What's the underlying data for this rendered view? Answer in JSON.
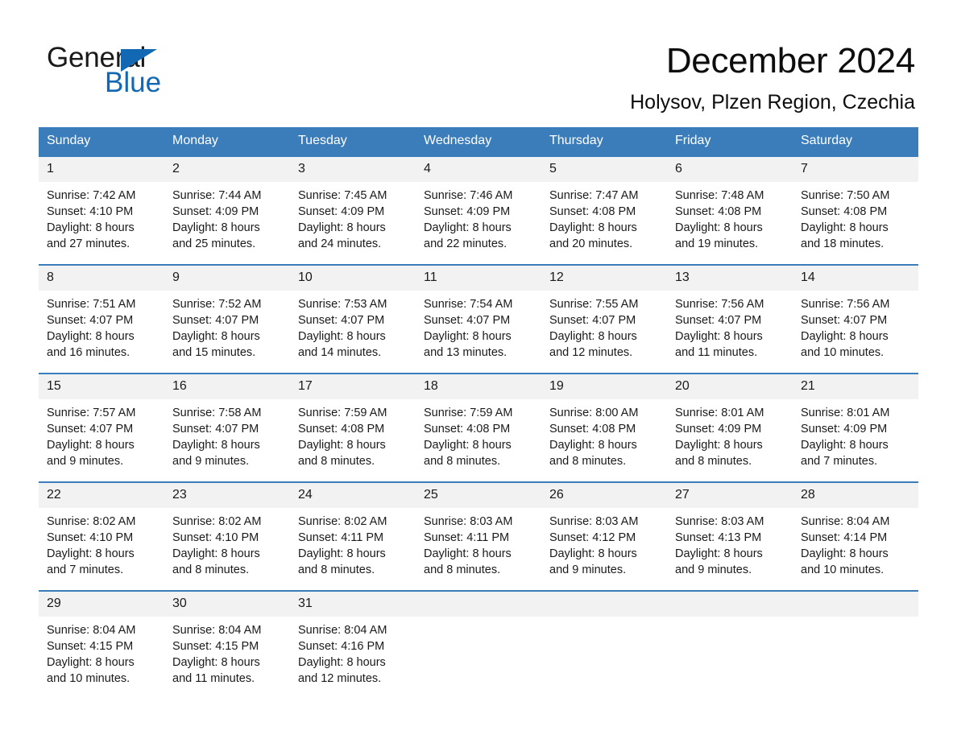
{
  "brand": {
    "name_part1": "General",
    "name_part2": "Blue",
    "triangle_icon": "triangle-icon",
    "accent_color": "#1268b3"
  },
  "header": {
    "month_title": "December 2024",
    "location": "Holysov, Plzen Region, Czechia"
  },
  "calendar": {
    "header_color": "#3b7cba",
    "weekday_headers": [
      "Sunday",
      "Monday",
      "Tuesday",
      "Wednesday",
      "Thursday",
      "Friday",
      "Saturday"
    ],
    "labels": {
      "sunrise": "Sunrise:",
      "sunset": "Sunset:",
      "daylight": "Daylight:"
    },
    "weeks": [
      [
        {
          "day": "1",
          "sunrise": "Sunrise: 7:42 AM",
          "sunset": "Sunset: 4:10 PM",
          "daylight_line1": "Daylight: 8 hours",
          "daylight_line2": "and 27 minutes."
        },
        {
          "day": "2",
          "sunrise": "Sunrise: 7:44 AM",
          "sunset": "Sunset: 4:09 PM",
          "daylight_line1": "Daylight: 8 hours",
          "daylight_line2": "and 25 minutes."
        },
        {
          "day": "3",
          "sunrise": "Sunrise: 7:45 AM",
          "sunset": "Sunset: 4:09 PM",
          "daylight_line1": "Daylight: 8 hours",
          "daylight_line2": "and 24 minutes."
        },
        {
          "day": "4",
          "sunrise": "Sunrise: 7:46 AM",
          "sunset": "Sunset: 4:09 PM",
          "daylight_line1": "Daylight: 8 hours",
          "daylight_line2": "and 22 minutes."
        },
        {
          "day": "5",
          "sunrise": "Sunrise: 7:47 AM",
          "sunset": "Sunset: 4:08 PM",
          "daylight_line1": "Daylight: 8 hours",
          "daylight_line2": "and 20 minutes."
        },
        {
          "day": "6",
          "sunrise": "Sunrise: 7:48 AM",
          "sunset": "Sunset: 4:08 PM",
          "daylight_line1": "Daylight: 8 hours",
          "daylight_line2": "and 19 minutes."
        },
        {
          "day": "7",
          "sunrise": "Sunrise: 7:50 AM",
          "sunset": "Sunset: 4:08 PM",
          "daylight_line1": "Daylight: 8 hours",
          "daylight_line2": "and 18 minutes."
        }
      ],
      [
        {
          "day": "8",
          "sunrise": "Sunrise: 7:51 AM",
          "sunset": "Sunset: 4:07 PM",
          "daylight_line1": "Daylight: 8 hours",
          "daylight_line2": "and 16 minutes."
        },
        {
          "day": "9",
          "sunrise": "Sunrise: 7:52 AM",
          "sunset": "Sunset: 4:07 PM",
          "daylight_line1": "Daylight: 8 hours",
          "daylight_line2": "and 15 minutes."
        },
        {
          "day": "10",
          "sunrise": "Sunrise: 7:53 AM",
          "sunset": "Sunset: 4:07 PM",
          "daylight_line1": "Daylight: 8 hours",
          "daylight_line2": "and 14 minutes."
        },
        {
          "day": "11",
          "sunrise": "Sunrise: 7:54 AM",
          "sunset": "Sunset: 4:07 PM",
          "daylight_line1": "Daylight: 8 hours",
          "daylight_line2": "and 13 minutes."
        },
        {
          "day": "12",
          "sunrise": "Sunrise: 7:55 AM",
          "sunset": "Sunset: 4:07 PM",
          "daylight_line1": "Daylight: 8 hours",
          "daylight_line2": "and 12 minutes."
        },
        {
          "day": "13",
          "sunrise": "Sunrise: 7:56 AM",
          "sunset": "Sunset: 4:07 PM",
          "daylight_line1": "Daylight: 8 hours",
          "daylight_line2": "and 11 minutes."
        },
        {
          "day": "14",
          "sunrise": "Sunrise: 7:56 AM",
          "sunset": "Sunset: 4:07 PM",
          "daylight_line1": "Daylight: 8 hours",
          "daylight_line2": "and 10 minutes."
        }
      ],
      [
        {
          "day": "15",
          "sunrise": "Sunrise: 7:57 AM",
          "sunset": "Sunset: 4:07 PM",
          "daylight_line1": "Daylight: 8 hours",
          "daylight_line2": "and 9 minutes."
        },
        {
          "day": "16",
          "sunrise": "Sunrise: 7:58 AM",
          "sunset": "Sunset: 4:07 PM",
          "daylight_line1": "Daylight: 8 hours",
          "daylight_line2": "and 9 minutes."
        },
        {
          "day": "17",
          "sunrise": "Sunrise: 7:59 AM",
          "sunset": "Sunset: 4:08 PM",
          "daylight_line1": "Daylight: 8 hours",
          "daylight_line2": "and 8 minutes."
        },
        {
          "day": "18",
          "sunrise": "Sunrise: 7:59 AM",
          "sunset": "Sunset: 4:08 PM",
          "daylight_line1": "Daylight: 8 hours",
          "daylight_line2": "and 8 minutes."
        },
        {
          "day": "19",
          "sunrise": "Sunrise: 8:00 AM",
          "sunset": "Sunset: 4:08 PM",
          "daylight_line1": "Daylight: 8 hours",
          "daylight_line2": "and 8 minutes."
        },
        {
          "day": "20",
          "sunrise": "Sunrise: 8:01 AM",
          "sunset": "Sunset: 4:09 PM",
          "daylight_line1": "Daylight: 8 hours",
          "daylight_line2": "and 8 minutes."
        },
        {
          "day": "21",
          "sunrise": "Sunrise: 8:01 AM",
          "sunset": "Sunset: 4:09 PM",
          "daylight_line1": "Daylight: 8 hours",
          "daylight_line2": "and 7 minutes."
        }
      ],
      [
        {
          "day": "22",
          "sunrise": "Sunrise: 8:02 AM",
          "sunset": "Sunset: 4:10 PM",
          "daylight_line1": "Daylight: 8 hours",
          "daylight_line2": "and 7 minutes."
        },
        {
          "day": "23",
          "sunrise": "Sunrise: 8:02 AM",
          "sunset": "Sunset: 4:10 PM",
          "daylight_line1": "Daylight: 8 hours",
          "daylight_line2": "and 8 minutes."
        },
        {
          "day": "24",
          "sunrise": "Sunrise: 8:02 AM",
          "sunset": "Sunset: 4:11 PM",
          "daylight_line1": "Daylight: 8 hours",
          "daylight_line2": "and 8 minutes."
        },
        {
          "day": "25",
          "sunrise": "Sunrise: 8:03 AM",
          "sunset": "Sunset: 4:11 PM",
          "daylight_line1": "Daylight: 8 hours",
          "daylight_line2": "and 8 minutes."
        },
        {
          "day": "26",
          "sunrise": "Sunrise: 8:03 AM",
          "sunset": "Sunset: 4:12 PM",
          "daylight_line1": "Daylight: 8 hours",
          "daylight_line2": "and 9 minutes."
        },
        {
          "day": "27",
          "sunrise": "Sunrise: 8:03 AM",
          "sunset": "Sunset: 4:13 PM",
          "daylight_line1": "Daylight: 8 hours",
          "daylight_line2": "and 9 minutes."
        },
        {
          "day": "28",
          "sunrise": "Sunrise: 8:04 AM",
          "sunset": "Sunset: 4:14 PM",
          "daylight_line1": "Daylight: 8 hours",
          "daylight_line2": "and 10 minutes."
        }
      ],
      [
        {
          "day": "29",
          "sunrise": "Sunrise: 8:04 AM",
          "sunset": "Sunset: 4:15 PM",
          "daylight_line1": "Daylight: 8 hours",
          "daylight_line2": "and 10 minutes."
        },
        {
          "day": "30",
          "sunrise": "Sunrise: 8:04 AM",
          "sunset": "Sunset: 4:15 PM",
          "daylight_line1": "Daylight: 8 hours",
          "daylight_line2": "and 11 minutes."
        },
        {
          "day": "31",
          "sunrise": "Sunrise: 8:04 AM",
          "sunset": "Sunset: 4:16 PM",
          "daylight_line1": "Daylight: 8 hours",
          "daylight_line2": "and 12 minutes."
        },
        {
          "day": "",
          "sunrise": "",
          "sunset": "",
          "daylight_line1": "",
          "daylight_line2": ""
        },
        {
          "day": "",
          "sunrise": "",
          "sunset": "",
          "daylight_line1": "",
          "daylight_line2": ""
        },
        {
          "day": "",
          "sunrise": "",
          "sunset": "",
          "daylight_line1": "",
          "daylight_line2": ""
        },
        {
          "day": "",
          "sunrise": "",
          "sunset": "",
          "daylight_line1": "",
          "daylight_line2": ""
        }
      ]
    ]
  }
}
